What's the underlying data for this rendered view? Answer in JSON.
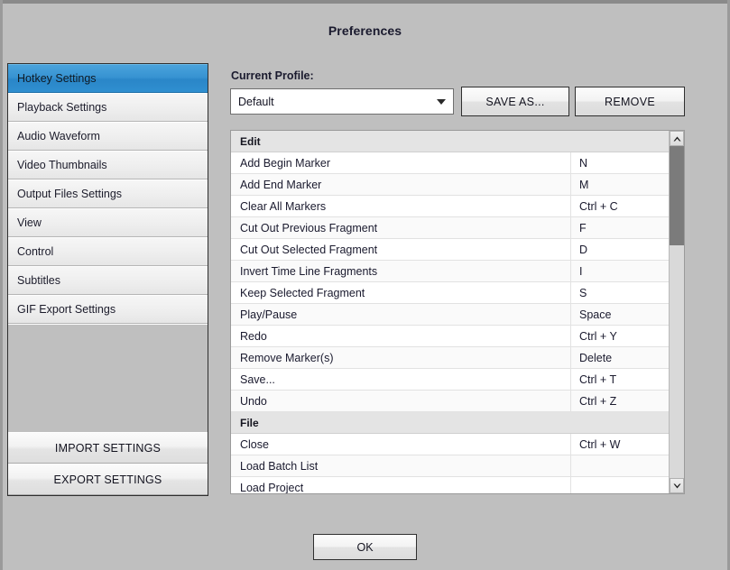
{
  "window": {
    "title": "Preferences"
  },
  "sidebar": {
    "items": [
      {
        "label": "Hotkey Settings",
        "selected": true
      },
      {
        "label": "Playback Settings",
        "selected": false
      },
      {
        "label": "Audio Waveform",
        "selected": false
      },
      {
        "label": "Video Thumbnails",
        "selected": false
      },
      {
        "label": "Output Files Settings",
        "selected": false
      },
      {
        "label": "View",
        "selected": false
      },
      {
        "label": "Control",
        "selected": false
      },
      {
        "label": "Subtitles",
        "selected": false
      },
      {
        "label": "GIF Export Settings",
        "selected": false
      }
    ],
    "import_button": "IMPORT SETTINGS",
    "export_button": "EXPORT SETTINGS"
  },
  "profile": {
    "label": "Current Profile:",
    "selected_value": "Default",
    "options": [
      "Default"
    ],
    "dropdown_icon": "chevron-down-icon",
    "save_as_button": "SAVE AS...",
    "remove_button": "REMOVE"
  },
  "hotkey_table": {
    "groups": [
      {
        "name": "Edit",
        "rows": [
          {
            "action": "Add Begin Marker",
            "shortcut": "N"
          },
          {
            "action": "Add End Marker",
            "shortcut": "M"
          },
          {
            "action": "Clear All Markers",
            "shortcut": "Ctrl + C"
          },
          {
            "action": "Cut Out Previous Fragment",
            "shortcut": "F"
          },
          {
            "action": "Cut Out Selected Fragment",
            "shortcut": "D"
          },
          {
            "action": "Invert Time Line Fragments",
            "shortcut": "I"
          },
          {
            "action": "Keep Selected Fragment",
            "shortcut": "S"
          },
          {
            "action": "Play/Pause",
            "shortcut": "Space"
          },
          {
            "action": "Redo",
            "shortcut": "Ctrl + Y"
          },
          {
            "action": "Remove Marker(s)",
            "shortcut": "Delete"
          },
          {
            "action": "Save...",
            "shortcut": "Ctrl + T"
          },
          {
            "action": "Undo",
            "shortcut": "Ctrl + Z"
          }
        ]
      },
      {
        "name": "File",
        "rows": [
          {
            "action": "Close",
            "shortcut": "Ctrl + W"
          },
          {
            "action": "Load Batch List",
            "shortcut": ""
          },
          {
            "action": "Load Project",
            "shortcut": ""
          }
        ]
      }
    ],
    "scrollbar": {
      "up_icon": "chevron-up-icon",
      "down_icon": "chevron-down-icon",
      "thumb_position": "top"
    }
  },
  "footer": {
    "ok_button": "OK"
  },
  "colors": {
    "accent": "#3793d2",
    "window_bg": "#bfbfbf",
    "group_header_bg": "#e4e4e4"
  }
}
